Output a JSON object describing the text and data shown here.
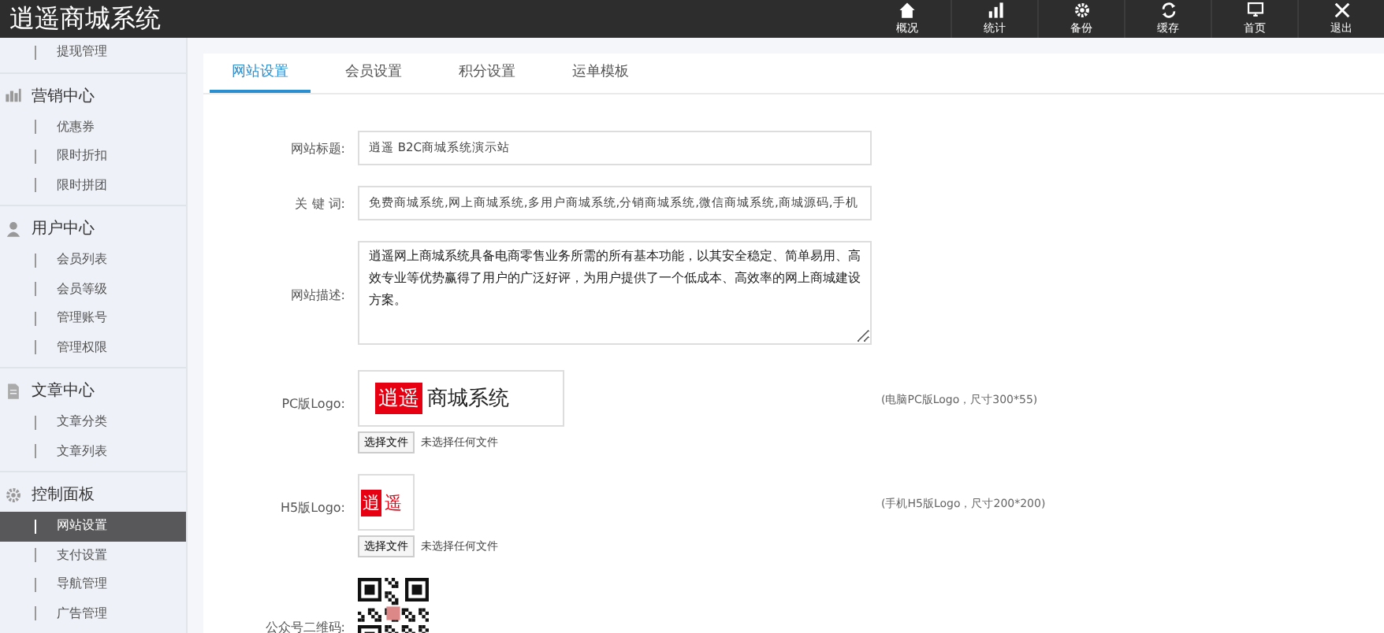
{
  "header": {
    "title": "逍遥商城系统",
    "actions": [
      {
        "kind": "home",
        "label": "概况"
      },
      {
        "kind": "stats",
        "label": "统计"
      },
      {
        "kind": "gear",
        "label": "备份"
      },
      {
        "kind": "refresh",
        "label": "缓存"
      },
      {
        "kind": "monitor",
        "label": "首页"
      },
      {
        "kind": "close",
        "label": "退出"
      }
    ]
  },
  "sidebar": {
    "leading_items": [
      {
        "label": "提现管理",
        "selected": false
      }
    ],
    "groups": [
      {
        "kind": "chart",
        "title": "营销中心",
        "items": [
          {
            "label": "优惠券",
            "selected": false
          },
          {
            "label": "限时折扣",
            "selected": false
          },
          {
            "label": "限时拼团",
            "selected": false
          }
        ]
      },
      {
        "kind": "user",
        "title": "用户中心",
        "items": [
          {
            "label": "会员列表",
            "selected": false
          },
          {
            "label": "会员等级",
            "selected": false
          },
          {
            "label": "管理账号",
            "selected": false
          },
          {
            "label": "管理权限",
            "selected": false
          }
        ]
      },
      {
        "kind": "doc",
        "title": "文章中心",
        "items": [
          {
            "label": "文章分类",
            "selected": false
          },
          {
            "label": "文章列表",
            "selected": false
          }
        ]
      },
      {
        "kind": "gear",
        "title": "控制面板",
        "items": [
          {
            "label": "网站设置",
            "selected": true
          },
          {
            "label": "支付设置",
            "selected": false
          },
          {
            "label": "导航管理",
            "selected": false
          },
          {
            "label": "广告管理",
            "selected": false
          }
        ]
      }
    ]
  },
  "tabs": [
    {
      "label": "网站设置",
      "selected": true
    },
    {
      "label": "会员设置",
      "selected": false
    },
    {
      "label": "积分设置",
      "selected": false
    },
    {
      "label": "运单模板",
      "selected": false
    }
  ],
  "form": [
    {
      "kind": "text",
      "label": "网站标题:",
      "value": "逍遥 B2C商城系统演示站"
    },
    {
      "kind": "text",
      "label": "关 键 词:",
      "value": "免费商城系统,网上商城系统,多用户商城系统,分销商城系统,微信商城系统,商城源码,手机"
    },
    {
      "kind": "textarea",
      "label": "网站描述:",
      "value": "逍遥网上商城系统具备电商零售业务所需的所有基本功能，以其安全稳定、简单易用、高效专业等优势赢得了用户的广泛好评，为用户提供了一个低成本、高效率的网上商城建设方案。"
    },
    {
      "kind": "logo_wide",
      "label": "PC版Logo:",
      "logo_mark": "逍遥",
      "logo_text": "商城系统",
      "file_button": "选择文件",
      "file_status": "未选择任何文件",
      "hint": "(电脑PC版Logo，尺寸300*55)"
    },
    {
      "kind": "logo_square",
      "label": "H5版Logo:",
      "logo_mark": "逍",
      "logo_text": "遥",
      "file_button": "选择文件",
      "file_status": "未选择任何文件",
      "hint": "(手机H5版Logo，尺寸200*200)"
    },
    {
      "kind": "qr",
      "label": "公众号二维码:"
    }
  ]
}
